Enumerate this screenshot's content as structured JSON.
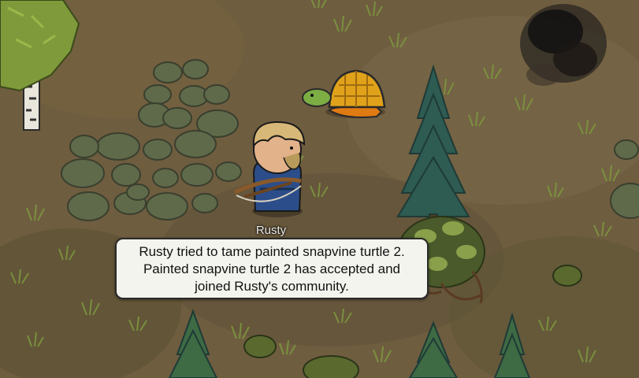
{
  "pawn": {
    "name": "Rusty"
  },
  "message": {
    "lines": [
      "Rusty tried to tame painted snapvine turtle 2.",
      "Painted snapvine turtle 2 has accepted and",
      "joined Rusty's community."
    ]
  },
  "icons": {
    "turtle": "painted-snapvine-turtle-icon",
    "colonist": "colonist-rusty-icon",
    "crossbow": "crossbow-icon"
  },
  "colors": {
    "ground": "#6b5a3e",
    "bubble_background": "#f4f4ef",
    "bubble_border": "#2a2a2a",
    "turtle_shell": "#e0a21a",
    "turtle_skin": "#7cae44",
    "colonist_coat": "#2b4e8a",
    "pine": "#2e5b52"
  }
}
